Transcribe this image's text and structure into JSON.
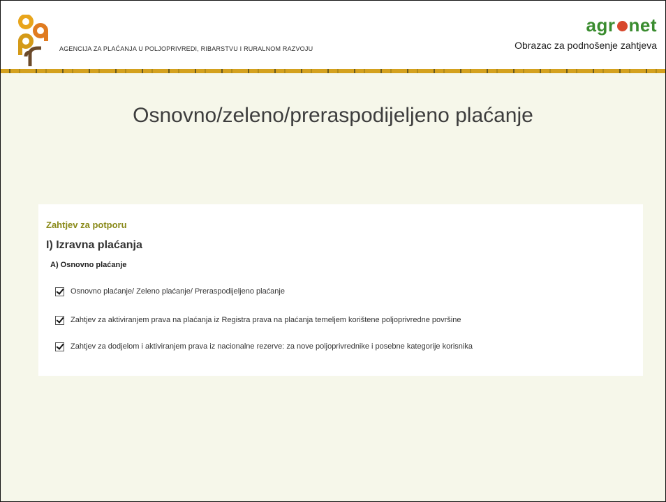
{
  "header": {
    "logo_text": "apprrr",
    "agency_name": "AGENCIJA ZA PLAĆANJA U POLJOPRIVREDI, RIBARSTVU I RURALNOM RAZVOJU",
    "brand_left": "agr",
    "brand_right": "net",
    "form_caption": "Obrazac za podnošenje zahtjeva"
  },
  "title": "Osnovno/zeleno/preraspodijeljeno plaćanje",
  "panel": {
    "subtitle": "Zahtjev za potporu",
    "heading": "I) Izravna plaćanja",
    "subheading": "A) Osnovno plaćanje",
    "options": [
      {
        "label": "Osnovno plaćanje/ Zeleno plaćanje/ Preraspodijeljeno plaćanje",
        "checked": true
      },
      {
        "label": "Zahtjev za aktiviranjem prava na plaćanja iz Registra prava na plaćanja temeljem korištene poljoprivredne površine",
        "checked": true
      },
      {
        "label": "Zahtjev za dodjelom i aktiviranjem prava iz nacionalne rezerve: za nove poljoprivrednike i posebne kategorije korisnika",
        "checked": true
      }
    ]
  },
  "colors": {
    "brand_green": "#3a8c2f",
    "accent_orange": "#e07b20",
    "stripe_gold": "#d4a11e",
    "subtitle_olive": "#8a8a1a"
  }
}
